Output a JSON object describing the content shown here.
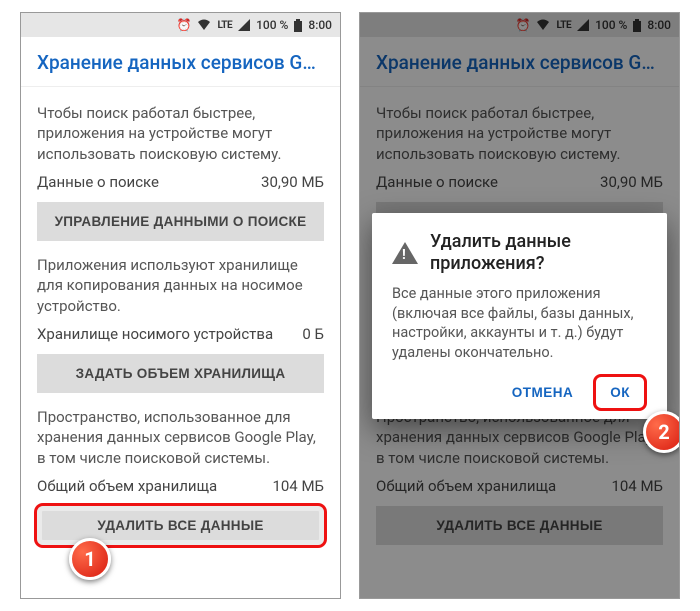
{
  "status": {
    "battery_pct": "100 %",
    "clock": "8:00",
    "network_label": "LTE"
  },
  "page": {
    "title": "Хранение данных сервисов Goo…",
    "search_para": "Чтобы поиск работал быстрее, приложения на устройстве могут использовать поисковую систему.",
    "search_row_label": "Данные о поиске",
    "search_row_value": "30,90 МБ",
    "btn_manage_search": "УПРАВЛЕНИЕ ДАННЫМИ О ПОИСКЕ",
    "wearable_para": "Приложения используют хранилище для копирования данных на носимое устройство.",
    "wearable_row_label": "Хранилище носимого устройства",
    "wearable_row_value": "0 Б",
    "btn_set_storage": "ЗАДАТЬ ОБЪЕМ ХРАНИЛИЩА",
    "play_para": "Пространство, использованное для хранения данных сервисов Google Play, в том числе поисковой системы.",
    "total_row_label": "Общий объем хранилища",
    "total_row_value": "104 МБ",
    "btn_clear_all": "УДАЛИТЬ ВСЕ ДАННЫЕ"
  },
  "dialog": {
    "title": "Удалить данные приложения?",
    "body": "Все данные этого приложения (включая все файлы, базы данных, настройки, аккаунты и т. д.) будут удалены окончательно.",
    "cancel": "ОТМЕНА",
    "ok": "ОК"
  },
  "badges": {
    "one": "1",
    "two": "2"
  }
}
